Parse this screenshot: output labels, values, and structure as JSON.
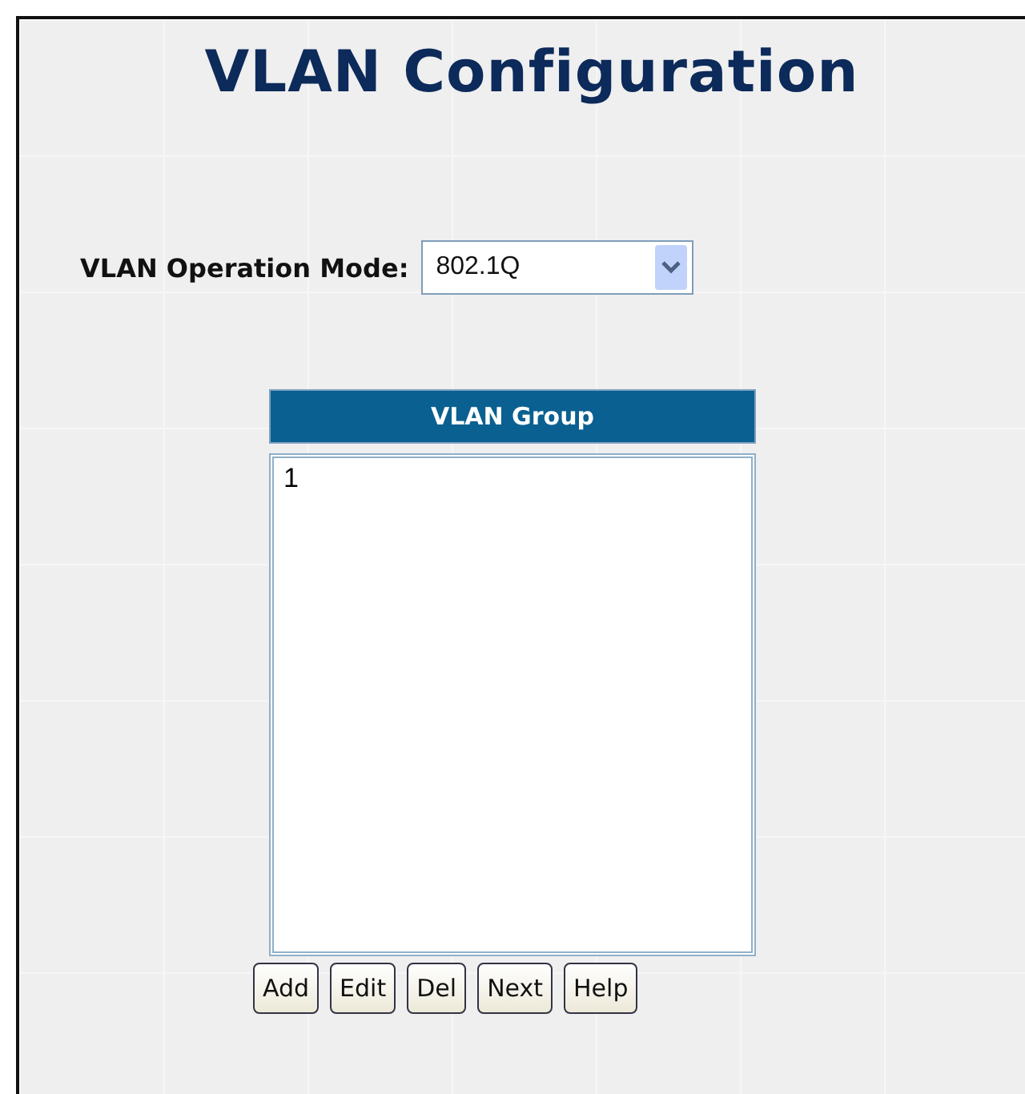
{
  "title": "VLAN Configuration",
  "operation_mode": {
    "label": "VLAN Operation Mode:",
    "value": "802.1Q"
  },
  "vlan_group": {
    "heading": "VLAN Group",
    "items": [
      {
        "label": "1",
        "selected": false
      }
    ]
  },
  "buttons": [
    "Add",
    "Edit",
    "Del",
    "Next",
    "Help"
  ]
}
